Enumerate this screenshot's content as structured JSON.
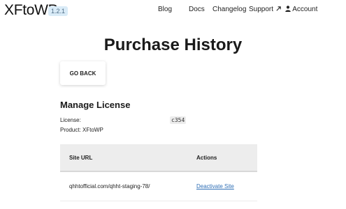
{
  "header": {
    "logo": "XFtoWP",
    "version": "1.2.1",
    "nav": {
      "blog": "Blog",
      "docs": "Docs",
      "changelog": "Changelog",
      "support": "Support",
      "account": "Account"
    }
  },
  "main": {
    "title": "Purchase History",
    "back_label": "GO BACK",
    "section_title": "Manage License",
    "license_label": "License:",
    "license_key": "c354",
    "product_line": "Product: XFtoWP"
  },
  "table": {
    "headers": [
      "Site URL",
      "Actions"
    ],
    "rows": [
      {
        "url": "qhhtofficial.com/qhht-staging-78/",
        "action": "Deactivate Site"
      }
    ]
  },
  "colors": {
    "accent_link": "#2f6fb6",
    "version_badge_bg": "#d9ebf7",
    "table_header_bg": "#ededed"
  }
}
